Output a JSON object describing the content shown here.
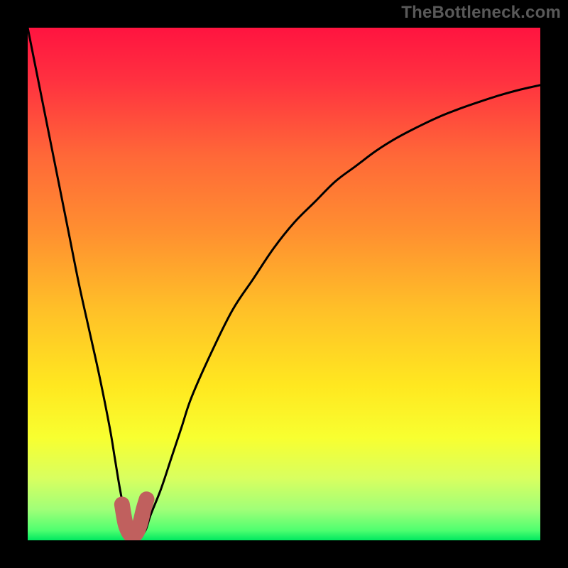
{
  "attribution": "TheBottleneck.com",
  "chart_data": {
    "type": "line",
    "title": "",
    "xlabel": "",
    "ylabel": "",
    "xlim": [
      0,
      100
    ],
    "ylim": [
      0,
      100
    ],
    "grid": false,
    "legend": false,
    "series": [
      {
        "name": "curve",
        "color": "#000000",
        "x": [
          0,
          2,
          4,
          6,
          8,
          10,
          12,
          14,
          16,
          17,
          18,
          19,
          20,
          21,
          22,
          23,
          24,
          26,
          28,
          30,
          32,
          36,
          40,
          44,
          48,
          52,
          56,
          60,
          64,
          68,
          72,
          76,
          80,
          84,
          88,
          92,
          96,
          100
        ],
        "y": [
          100,
          90,
          80,
          70,
          60,
          50,
          41,
          32,
          22,
          16,
          10,
          5,
          2,
          1,
          1,
          2,
          5,
          10,
          16,
          22,
          28,
          37,
          45,
          51,
          57,
          62,
          66,
          70,
          73,
          76,
          78.5,
          80.6,
          82.5,
          84.1,
          85.5,
          86.8,
          87.9,
          88.8
        ]
      },
      {
        "name": "valley-highlight",
        "color": "#c0605e",
        "x": [
          18.4,
          19.0,
          19.6,
          20.2,
          20.8,
          21.4,
          22.0,
          22.6,
          23.2
        ],
        "y": [
          7.0,
          3.5,
          1.8,
          1.0,
          1.0,
          1.8,
          3.5,
          6.0,
          8.0
        ]
      }
    ],
    "background_gradient": {
      "stops": [
        {
          "offset": 0.0,
          "color": "#ff1440"
        },
        {
          "offset": 0.1,
          "color": "#ff3040"
        },
        {
          "offset": 0.25,
          "color": "#ff6838"
        },
        {
          "offset": 0.4,
          "color": "#ff9030"
        },
        {
          "offset": 0.55,
          "color": "#ffc028"
        },
        {
          "offset": 0.7,
          "color": "#ffe820"
        },
        {
          "offset": 0.8,
          "color": "#f8ff30"
        },
        {
          "offset": 0.88,
          "color": "#d8ff60"
        },
        {
          "offset": 0.94,
          "color": "#a0ff78"
        },
        {
          "offset": 0.98,
          "color": "#50ff70"
        },
        {
          "offset": 1.0,
          "color": "#00e860"
        }
      ]
    }
  }
}
